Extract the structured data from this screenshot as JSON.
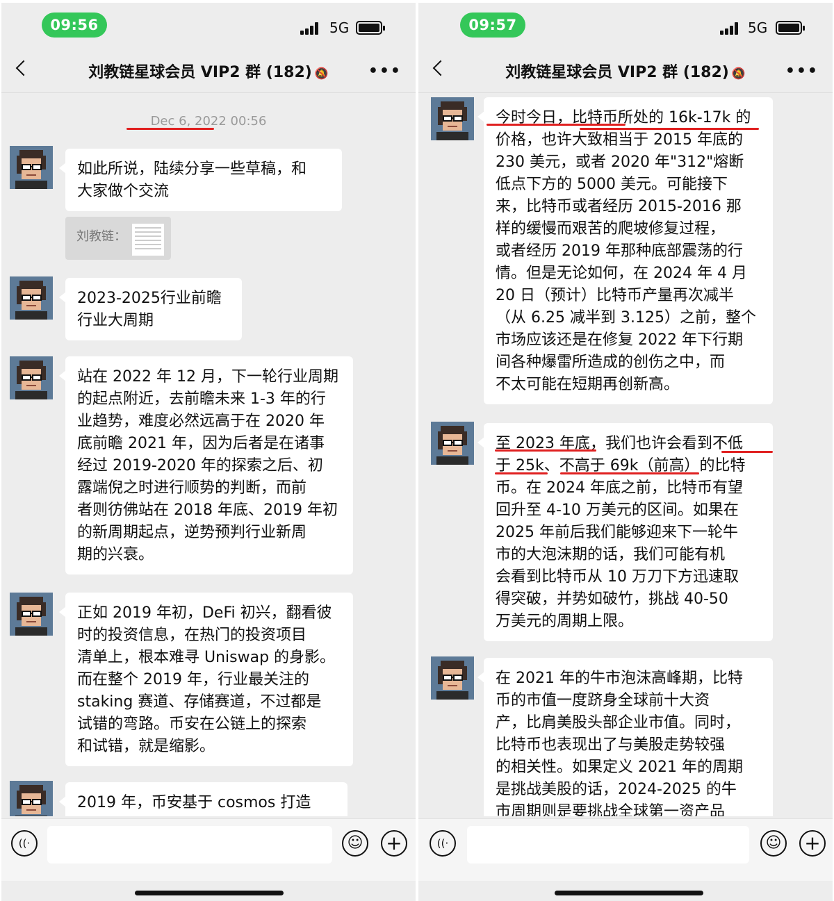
{
  "left": {
    "status": {
      "time": "09:56",
      "network": "5G"
    },
    "nav": {
      "title": "刘教链星球会员 VIP2 群 (182)"
    },
    "timestamp": "Dec 6, 2022 00:56",
    "file_card": {
      "sender": "刘教链："
    },
    "messages": [
      {
        "text": "如此所说，陆续分享一些草稿，和\n大家做个交流"
      },
      {
        "text": "2023-2025行业前瞻\n行业大周期"
      },
      {
        "text": "站在 2022 年 12 月，下一轮行业周期\n的起点附近，去前瞻未来 1-3 年的行\n业趋势，难度必然远高于在 2020 年\n底前瞻 2021 年，因为后者是在诸事\n经过 2019-2020 年的探索之后、初\n露端倪之时进行顺势的判断，而前\n者则彷佛站在 2018 年底、2019 年初\n的新周期起点，逆势预判行业新周\n期的兴衰。"
      },
      {
        "text": "正如 2019 年初，DeFi 初兴，翻看彼\n时的投资信息，在热门的投资项目\n清单上，根本难寻 Uniswap 的身影。\n而在整个 2019 年，行业最关注的\nstaking 赛道、存储赛道，不过都是\n试错的弯路。币安在公链上的探索\n和试错，就是缩影。"
      },
      {
        "text": "2019 年，币安基于 cosmos 打造\n"
      }
    ]
  },
  "right": {
    "status": {
      "time": "09:57",
      "network": "5G"
    },
    "nav": {
      "title": "刘教链星球会员 VIP2 群 (182)"
    },
    "messages": [
      {
        "text": "今时今日，比特币所处的 16k-17k 的\n价格，也许大致相当于 2015 年底的\n230 美元，或者 2020 年\"312\"熔断\n低点下方的 5000 美元。可能接下\n来，比特币或者经历 2015-2016 那\n样的缓慢而艰苦的爬坡修复过程，\n或者经历 2019 年那种底部震荡的行\n情。但是无论如何，在 2024 年 4 月\n20 日（预计）比特币产量再次减半\n（从 6.25 减半到 3.125）之前，整个\n市场应该还是在修复 2022 年下行期\n间各种爆雷所造成的创伤之中，而\n不太可能在短期再创新高。"
      },
      {
        "text": "至 2023 年底，我们也许会看到不低\n于 25k、不高于 69k（前高）的比特\n币。在 2024 年底之前，比特币有望\n回升至 4-10 万美元的区间。如果在\n2025 年前后我们能够迎来下一轮牛\n市的大泡沫期的话，我们可能有机\n会看到比特币从 10 万刀下方迅速取\n得突破，并势如破竹，挑战 40-50\n万美元的周期上限。"
      },
      {
        "text": "在 2021 年的牛市泡沫高峰期，比特\n币的市值一度跻身全球前十大资\n产，比肩美股头部企业市值。同时，\n比特币也表现出了与美股走势较强\n的相关性。如果定义 2021 年的周期\n是挑战美股的话，2024-2025 的牛\n市周期则是要挑战全球第一资产品"
      }
    ]
  },
  "colors": {
    "time_pill": "#34c759",
    "chat_bg": "#ededed",
    "annotation": "#e02020"
  },
  "icons": [
    "back-arrow-icon",
    "mute-bell-icon",
    "more-dots-icon",
    "voice-icon",
    "emoji-icon",
    "plus-icon",
    "signal-icon",
    "battery-icon",
    "document-icon"
  ]
}
